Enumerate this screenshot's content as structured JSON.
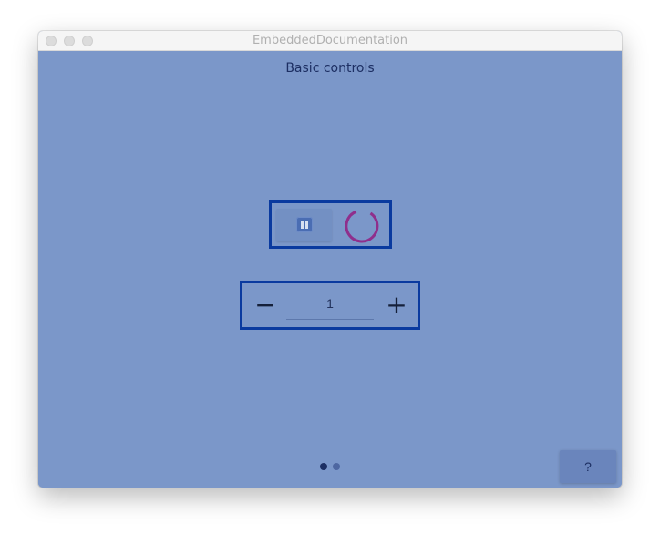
{
  "window": {
    "title": "EmbeddedDocumentation"
  },
  "page": {
    "title": "Basic controls"
  },
  "controls": {
    "pause_icon": "pause-icon",
    "busy_indicator_color": "#8f2f8c",
    "stepper": {
      "value": "1",
      "decrement_label": "−",
      "increment_label": "+"
    }
  },
  "page_indicator": {
    "count": 2,
    "active_index": 0
  },
  "help_button": {
    "label": "?"
  }
}
